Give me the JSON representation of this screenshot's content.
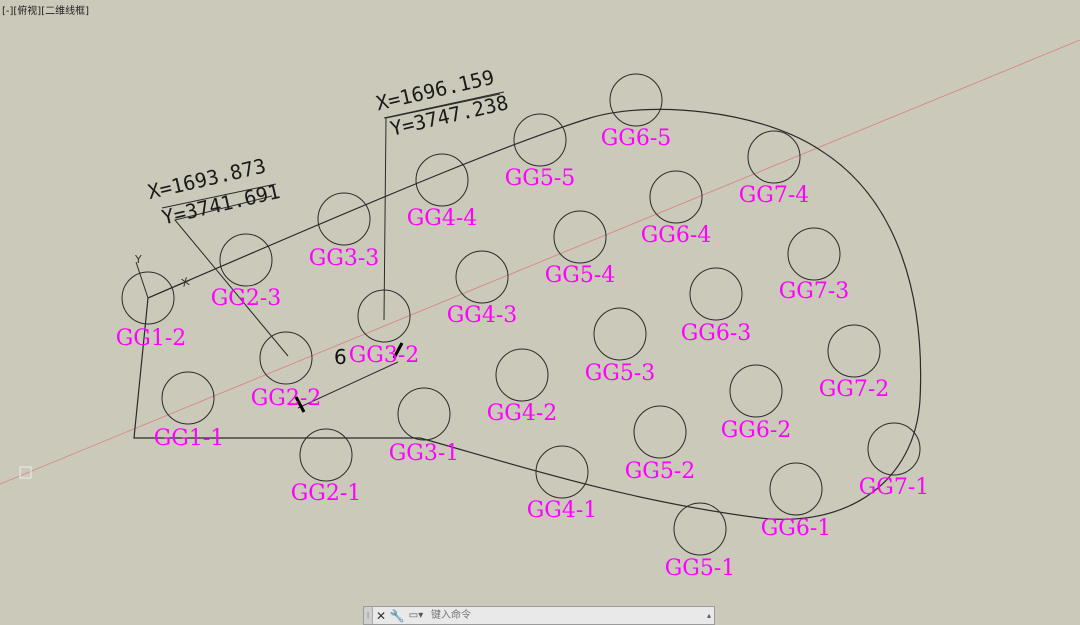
{
  "viewport": {
    "label": "[-][俯视][二维线框]"
  },
  "holes": [
    {
      "label": "GG1-2"
    },
    {
      "label": "GG1-1"
    },
    {
      "label": "GG2-3"
    },
    {
      "label": "GG2-2"
    },
    {
      "label": "GG2-1"
    },
    {
      "label": "GG3-3"
    },
    {
      "label": "GG3-2"
    },
    {
      "label": "GG3-1"
    },
    {
      "label": "GG4-4"
    },
    {
      "label": "GG4-3"
    },
    {
      "label": "GG4-2"
    },
    {
      "label": "GG4-1"
    },
    {
      "label": "GG5-5"
    },
    {
      "label": "GG5-4"
    },
    {
      "label": "GG5-3"
    },
    {
      "label": "GG5-2"
    },
    {
      "label": "GG5-1"
    },
    {
      "label": "GG6-5"
    },
    {
      "label": "GG6-4"
    },
    {
      "label": "GG6-3"
    },
    {
      "label": "GG6-2"
    },
    {
      "label": "GG6-1"
    },
    {
      "label": "GG7-4"
    },
    {
      "label": "GG7-3"
    },
    {
      "label": "GG7-2"
    },
    {
      "label": "GG7-1"
    }
  ],
  "coordinates": [
    {
      "x": "X=1693.873",
      "y": "Y=3741.691"
    },
    {
      "x": "X=1696.159",
      "y": "Y=3747.238"
    }
  ],
  "dimension": {
    "value": "6"
  },
  "ucs": {
    "x_label": "X",
    "y_label": "Y"
  },
  "command_bar": {
    "placeholder": "键入命令",
    "close_icon": "close-icon",
    "settings_icon": "wrench-icon",
    "recent_icon": "recent-commands-icon"
  },
  "colors": {
    "background": "#cbc9b9",
    "labels": "#ff00ff",
    "lines": "#2a2a2a",
    "axis": "#d88080"
  }
}
